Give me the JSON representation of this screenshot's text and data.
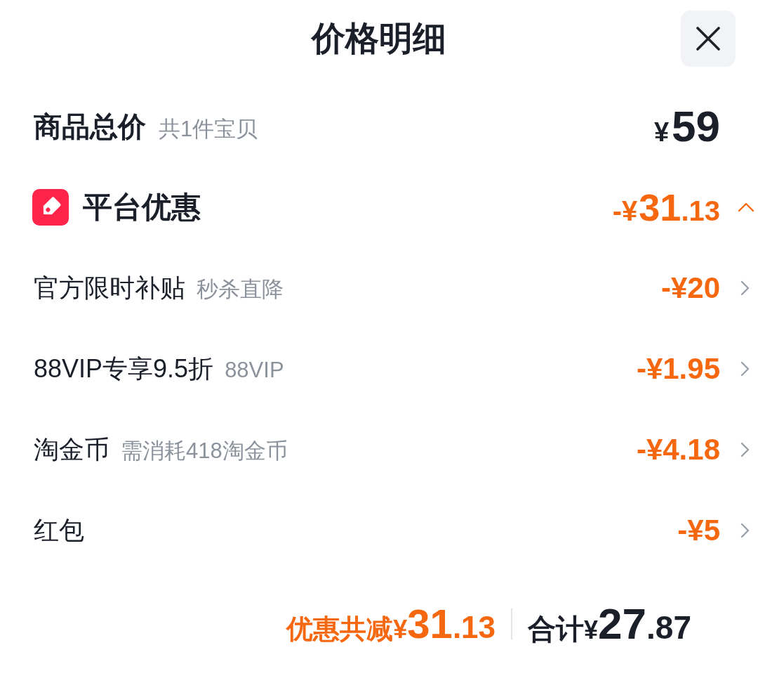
{
  "header": {
    "title": "价格明细"
  },
  "subtotal": {
    "label": "商品总价",
    "note": "共1件宝贝",
    "amount": {
      "currency": "¥",
      "whole": "59"
    }
  },
  "platform_discount": {
    "label": "平台优惠",
    "expanded": true,
    "amount": {
      "prefix": "-¥",
      "whole": "31",
      "fraction": ".13"
    },
    "items": [
      {
        "label": "官方限时补贴",
        "note": "秒杀直降",
        "amount": "-¥20"
      },
      {
        "label": "88VIP专享9.5折",
        "note": "88VIP",
        "amount": "-¥1.95"
      },
      {
        "label": "淘金币",
        "note": "需消耗418淘金币",
        "amount": "-¥4.18"
      },
      {
        "label": "红包",
        "amount": "-¥5"
      }
    ]
  },
  "footer": {
    "savings": {
      "label": "优惠共减",
      "currency": "¥",
      "whole": "31",
      "fraction": ".13"
    },
    "total": {
      "label": "合计",
      "currency": "¥",
      "whole": "27",
      "fraction": ".87"
    }
  }
}
